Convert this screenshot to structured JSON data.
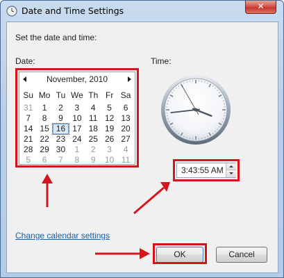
{
  "window": {
    "title": "Date and Time Settings",
    "close_glyph": "✕"
  },
  "dialog": {
    "heading": "Set the date and time:",
    "date_label": "Date:",
    "time_label": "Time:"
  },
  "calendar": {
    "month_title": "November, 2010",
    "days_of_week": [
      "Su",
      "Mo",
      "Tu",
      "We",
      "Th",
      "Fr",
      "Sa"
    ],
    "weeks": [
      [
        "31",
        "1",
        "2",
        "3",
        "4",
        "5",
        "6"
      ],
      [
        "7",
        "8",
        "9",
        "10",
        "11",
        "12",
        "13"
      ],
      [
        "14",
        "15",
        "16",
        "17",
        "18",
        "19",
        "20"
      ],
      [
        "21",
        "22",
        "23",
        "24",
        "25",
        "26",
        "27"
      ],
      [
        "28",
        "29",
        "30",
        "1",
        "2",
        "3",
        "4"
      ],
      [
        "5",
        "6",
        "7",
        "8",
        "9",
        "10",
        "11"
      ]
    ],
    "selected_day": "16",
    "prev_icon": "triangle-left-icon",
    "next_icon": "triangle-right-icon"
  },
  "clock": {
    "hour": 3,
    "minute": 43,
    "second": 55
  },
  "time_field": {
    "value": "3:43:55 AM"
  },
  "links": {
    "change_calendar": "Change calendar settings"
  },
  "buttons": {
    "ok": "OK",
    "cancel": "Cancel"
  },
  "colors": {
    "highlight": "#d6141c",
    "link": "#1a5ea8",
    "titlebar": "#b9cfe8",
    "close": "#c7372e"
  }
}
